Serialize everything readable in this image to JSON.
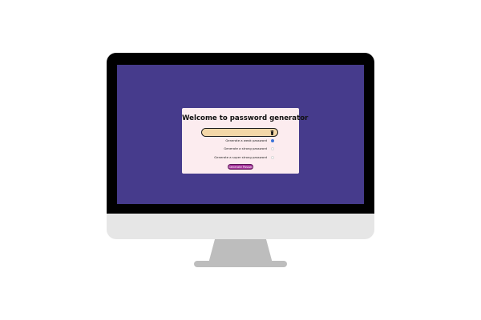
{
  "app": {
    "title": "Welcome to password generator",
    "password": {
      "value": ""
    },
    "options": [
      {
        "label": "Generate a weak password",
        "checked": true
      },
      {
        "label": "Generate a strong password",
        "checked": false
      },
      {
        "label": "Generate a super strong password",
        "checked": false
      }
    ],
    "generate_label": "Generate Password",
    "colors": {
      "screen": "#463b8c",
      "card": "#fcecef",
      "field": "#f3d7a8",
      "button": "#a5359b"
    },
    "icons": {
      "clear": "trash-icon"
    }
  }
}
